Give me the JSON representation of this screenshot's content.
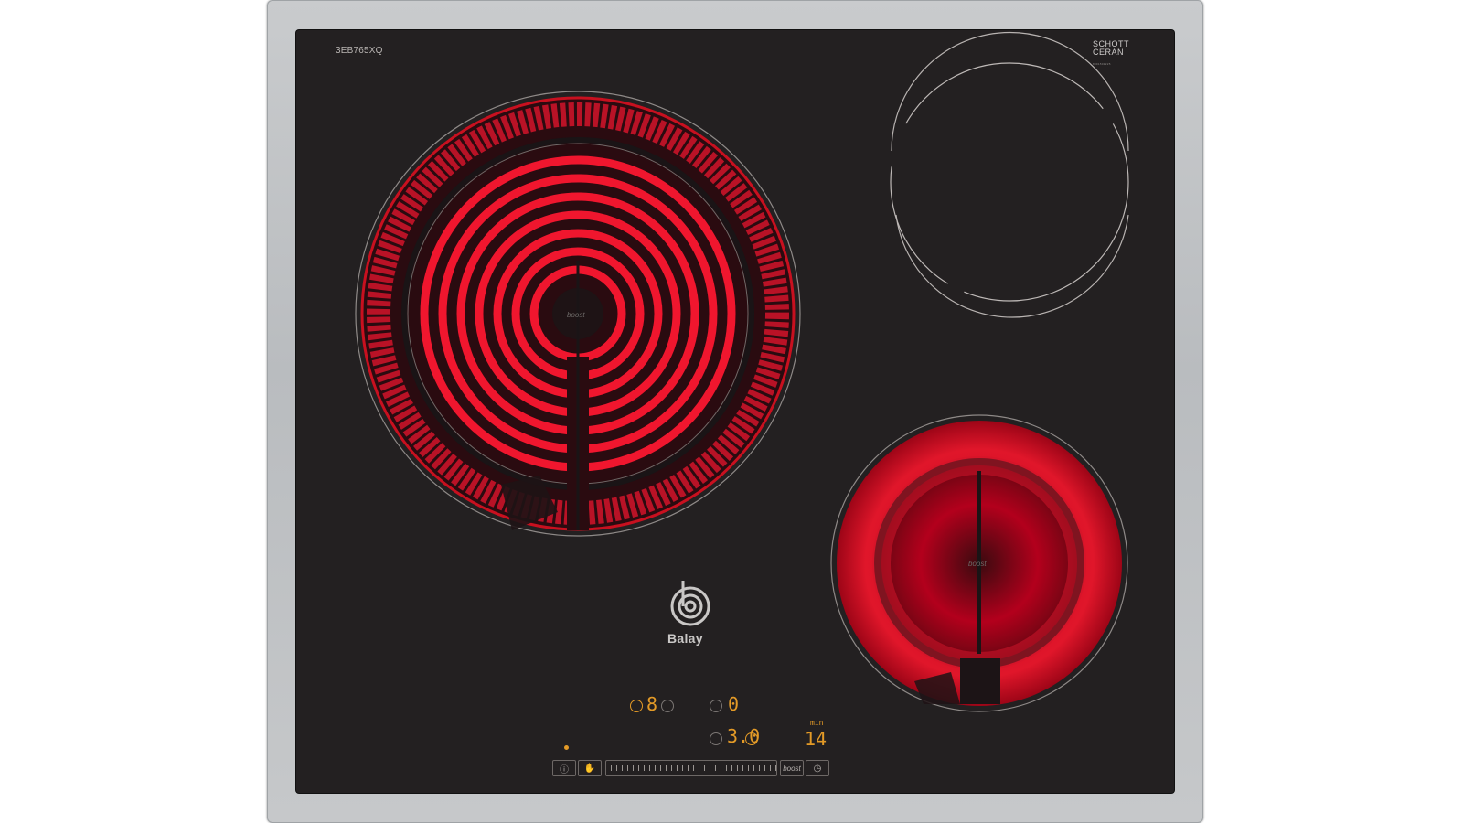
{
  "hob": {
    "model": "3EB765XQ",
    "glass_brand_line1": "SCHOTT",
    "glass_brand_line2": "CERAN",
    "glass_brand_fine_print": "8001501225"
  },
  "zones": [
    {
      "name": "rear-left-zone",
      "state": "on",
      "boost_label": "boost"
    },
    {
      "name": "rear-right-zone",
      "state": "off"
    },
    {
      "name": "front-right-zone",
      "state": "on",
      "boost_label": "boost"
    }
  ],
  "logo": {
    "brand": "Balay"
  },
  "display": {
    "zone_level_1": "8",
    "zone_level_2": "0",
    "zone_level_3": "3.0",
    "timer_unit": "min",
    "timer_value": "14"
  },
  "controls": {
    "power_icon": "power-info-icon",
    "childlock_icon": "childlock-icon",
    "boost_label": "boost",
    "timer_icon": "clock-icon"
  },
  "colors": {
    "glass": "#232021",
    "frame": "#c0c2c4",
    "heat": "#e8112a",
    "display": "#e39a27"
  }
}
